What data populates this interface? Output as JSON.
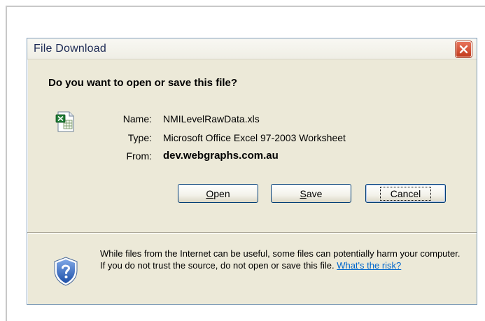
{
  "dialog": {
    "title": "File Download",
    "question": "Do you want to open or save this file?",
    "file": {
      "name_label": "Name:",
      "name_value": "NMILevelRawData.xls",
      "type_label": "Type:",
      "type_value": "Microsoft Office Excel 97-2003 Worksheet",
      "from_label": "From:",
      "from_value": "dev.webgraphs.com.au"
    },
    "buttons": {
      "open_mnemonic": "O",
      "open_rest": "pen",
      "save_mnemonic": "S",
      "save_rest": "ave",
      "cancel": "Cancel"
    },
    "warning": {
      "text": "While files from the Internet can be useful, some files can potentially harm your computer. If you do not trust the source, do not open or save this file. ",
      "link": "What's the risk?"
    },
    "icons": {
      "file": "excel-file-icon",
      "warning": "shield-question-icon",
      "close": "close-icon"
    },
    "colors": {
      "close_button": "#c23b1d",
      "dialog_background": "#ece9d8",
      "link": "#0066cc"
    }
  }
}
